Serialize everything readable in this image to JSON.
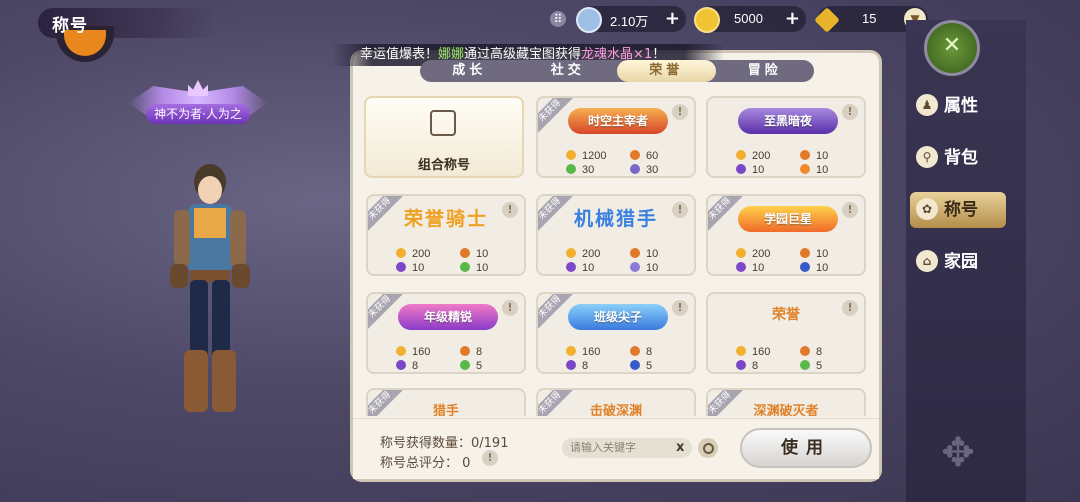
{
  "header": {
    "title": "称号"
  },
  "currency": [
    {
      "name": "diamond",
      "value": "2.10万",
      "color": "#8fb6e0"
    },
    {
      "name": "gold",
      "value": "5000",
      "color": "#f1c232"
    },
    {
      "name": "gem",
      "value": "15",
      "color": "#e8b22a"
    }
  ],
  "character": {
    "title_badge": "神不为者·人为之"
  },
  "announcement": {
    "prefix": "幸运值爆表！",
    "player": "娜娜",
    "middle": "通过高级藏宝图获得",
    "item": "龙魂水晶×1",
    "suffix": "！"
  },
  "tabs": [
    "成长",
    "社交",
    "荣誉",
    "冒险"
  ],
  "active_tab": "荣誉",
  "combo": {
    "label": "组合称号"
  },
  "ribbon_text": "未获得",
  "cards": [
    {
      "name": "时空主宰者",
      "style": "badge",
      "colors": [
        "#f6b050",
        "#d8452a"
      ],
      "stats": [
        "1200",
        "60",
        "30",
        "30"
      ]
    },
    {
      "name": "至黑暗夜",
      "style": "badge",
      "colors": [
        "#a78ae0",
        "#5b2fa8"
      ],
      "stats": [
        "200",
        "10",
        "10",
        "10"
      ]
    },
    {
      "name": "荣誉骑士",
      "style": "big",
      "color": "#f0a020",
      "stats": [
        "200",
        "10",
        "10",
        "10"
      ]
    },
    {
      "name": "机械猎手",
      "style": "big",
      "color": "#3a80e0",
      "stats": [
        "200",
        "10",
        "10",
        "10"
      ]
    },
    {
      "name": "学园巨星",
      "style": "badge",
      "colors": [
        "#ffd24a",
        "#f06a2a"
      ],
      "stats": [
        "200",
        "10",
        "10",
        "10"
      ]
    },
    {
      "name": "年级精锐",
      "style": "badge",
      "colors": [
        "#f07ac6",
        "#8a3ac8"
      ],
      "stats": [
        "160",
        "8",
        "8",
        "5"
      ]
    },
    {
      "name": "班级尖子",
      "style": "badge",
      "colors": [
        "#8ad0f8",
        "#3a7ae0"
      ],
      "stats": [
        "160",
        "8",
        "8",
        "5"
      ]
    },
    {
      "name": "荣誉",
      "style": "plain",
      "stats": [
        "160",
        "8",
        "8",
        "5"
      ]
    }
  ],
  "partial_cards": [
    "猎手",
    "击破深渊",
    "深渊破灭者"
  ],
  "footer": {
    "count_label": "称号获得数量：0/191",
    "score_label": "称号总评分：  0",
    "search_placeholder": "请输入关键字",
    "clear": "x",
    "use_button": "使用"
  },
  "nav": [
    {
      "label": "属性",
      "icon": "attributes-icon",
      "active": false
    },
    {
      "label": "背包",
      "icon": "bag-icon",
      "active": false
    },
    {
      "label": "称号",
      "icon": "title-icon",
      "active": true
    },
    {
      "label": "家园",
      "icon": "home-icon",
      "active": false
    }
  ]
}
